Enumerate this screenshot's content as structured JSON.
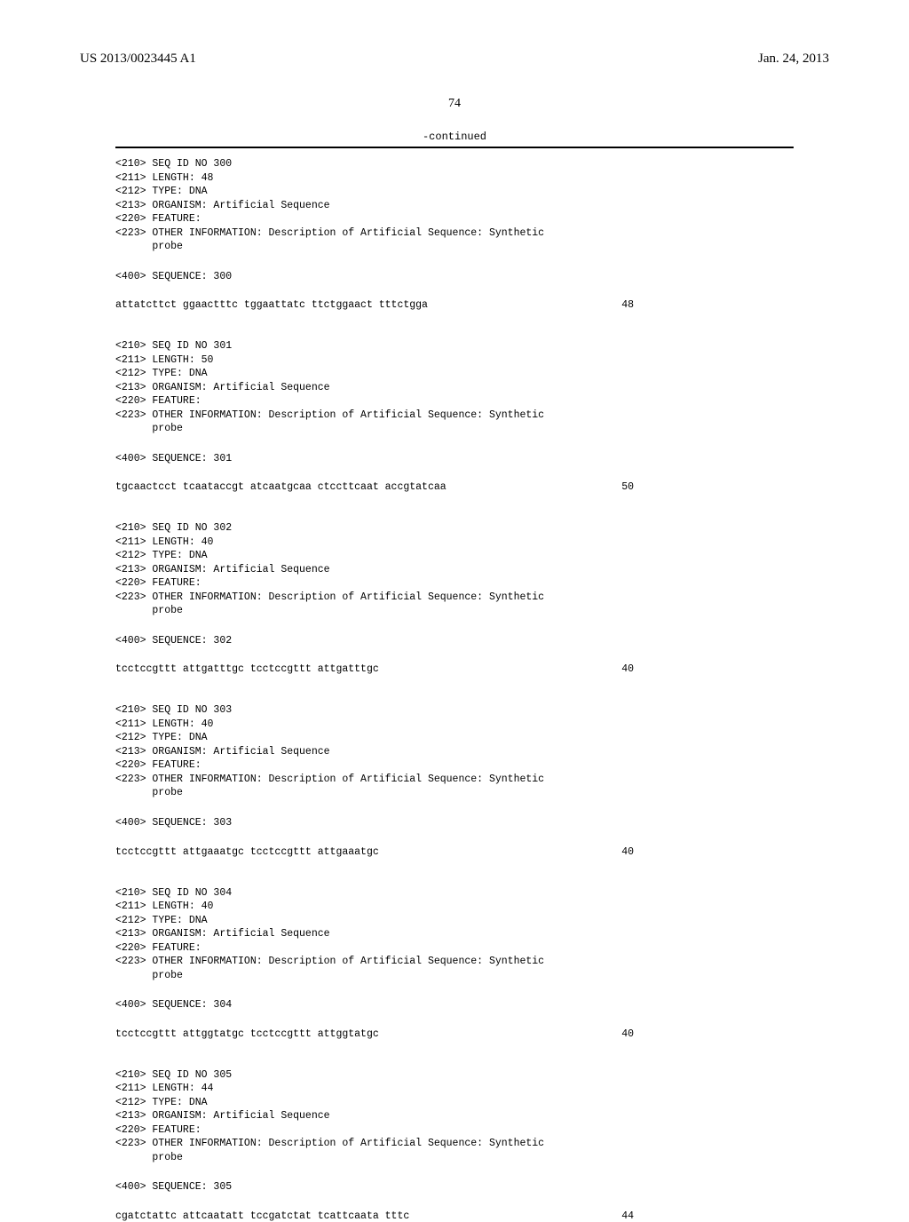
{
  "header": {
    "pub_number": "US 2013/0023445 A1",
    "pub_date": "Jan. 24, 2013"
  },
  "page_number": "74",
  "continued_label": "-continued",
  "sequences": [
    {
      "meta": "<210> SEQ ID NO 300\n<211> LENGTH: 48\n<212> TYPE: DNA\n<213> ORGANISM: Artificial Sequence\n<220> FEATURE:\n<223> OTHER INFORMATION: Description of Artificial Sequence: Synthetic\n      probe",
      "seq_header": "<400> SEQUENCE: 300",
      "sequence": "attatcttct ggaactttc tggaattatc ttctggaact tttctgga",
      "length": "48"
    },
    {
      "meta": "<210> SEQ ID NO 301\n<211> LENGTH: 50\n<212> TYPE: DNA\n<213> ORGANISM: Artificial Sequence\n<220> FEATURE:\n<223> OTHER INFORMATION: Description of Artificial Sequence: Synthetic\n      probe",
      "seq_header": "<400> SEQUENCE: 301",
      "sequence": "tgcaactcct tcaataccgt atcaatgcaa ctccttcaat accgtatcaa",
      "length": "50"
    },
    {
      "meta": "<210> SEQ ID NO 302\n<211> LENGTH: 40\n<212> TYPE: DNA\n<213> ORGANISM: Artificial Sequence\n<220> FEATURE:\n<223> OTHER INFORMATION: Description of Artificial Sequence: Synthetic\n      probe",
      "seq_header": "<400> SEQUENCE: 302",
      "sequence": "tcctccgttt attgatttgc tcctccgttt attgatttgc",
      "length": "40"
    },
    {
      "meta": "<210> SEQ ID NO 303\n<211> LENGTH: 40\n<212> TYPE: DNA\n<213> ORGANISM: Artificial Sequence\n<220> FEATURE:\n<223> OTHER INFORMATION: Description of Artificial Sequence: Synthetic\n      probe",
      "seq_header": "<400> SEQUENCE: 303",
      "sequence": "tcctccgttt attgaaatgc tcctccgttt attgaaatgc",
      "length": "40"
    },
    {
      "meta": "<210> SEQ ID NO 304\n<211> LENGTH: 40\n<212> TYPE: DNA\n<213> ORGANISM: Artificial Sequence\n<220> FEATURE:\n<223> OTHER INFORMATION: Description of Artificial Sequence: Synthetic\n      probe",
      "seq_header": "<400> SEQUENCE: 304",
      "sequence": "tcctccgttt attggtatgc tcctccgttt attggtatgc",
      "length": "40"
    },
    {
      "meta": "<210> SEQ ID NO 305\n<211> LENGTH: 44\n<212> TYPE: DNA\n<213> ORGANISM: Artificial Sequence\n<220> FEATURE:\n<223> OTHER INFORMATION: Description of Artificial Sequence: Synthetic\n      probe",
      "seq_header": "<400> SEQUENCE: 305",
      "sequence": "cgatctattc attcaatatt tccgatctat tcattcaata tttc",
      "length": "44"
    }
  ]
}
